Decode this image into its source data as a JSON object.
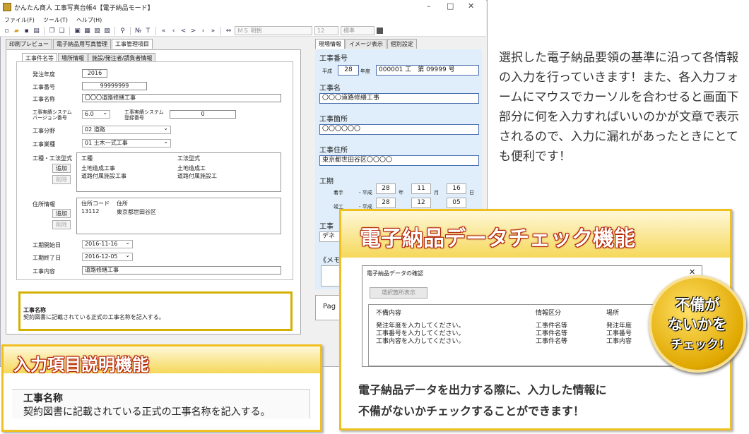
{
  "window": {
    "title": "かんたん商人 工事写真台帳4【電子納品モード】",
    "minimize": "–",
    "maximize": "□",
    "close": "✕"
  },
  "menu": [
    "ファイル(F)",
    "ツール(T)",
    "ヘルプ(H)"
  ],
  "toolbar": {
    "font_name": "ＭＳ 明朝",
    "font_size": "12",
    "style": "標準"
  },
  "main_tabs": [
    "印刷プレビュー",
    "電子納品用写真管理",
    "工事管理項目"
  ],
  "sub_tabs": [
    "工事件名等",
    "場所情報",
    "施設/発注者/請負者情報"
  ],
  "form": {
    "year_label": "発注年度",
    "year": "2016",
    "no_label": "工事番号",
    "no": "99999999",
    "name_label": "工事名称",
    "name": "〇〇〇道路修繕工事",
    "sys_ver_label1": "工事実績システム",
    "sys_ver_label2": "バージョン番号",
    "sys_ver": "6.0",
    "sys_no_label1": "工事実績システム",
    "sys_no_label2": "登録番号",
    "sys_no": "0",
    "field_label": "工事分野",
    "field": "02 道路",
    "type_label": "工事業種",
    "type": "01 土木一式工事",
    "method_label": "工種・工法型式",
    "add": "追加",
    "delete": "削除",
    "method_cols": [
      "工種",
      "工法型式"
    ],
    "method_rows": [
      [
        "土地造成工事",
        "土地造成工"
      ],
      [
        "道路付属施設工事",
        "道路付属施設工"
      ]
    ],
    "place_label": "住所情報",
    "place_cols": [
      "住所コード",
      "住所"
    ],
    "place_rows": [
      [
        "13112",
        "東京都世田谷区"
      ]
    ],
    "start_label": "工期開始日",
    "start": "2016-11-16",
    "end_label": "工期終了日",
    "end": "2016-12-05",
    "content_label": "工事内容",
    "content": "道路修繕工事"
  },
  "help": {
    "title": "工事名称",
    "text": "契約図書に記載されている正式の工事名称を記入する。"
  },
  "right_tabs": [
    "現場情報",
    "イメージ表示",
    "個別設定"
  ],
  "right": {
    "no_label": "工事番号",
    "era": "平成",
    "era_year": "28",
    "year_unit": "年度",
    "no_value": "000001 工　第 09999 号",
    "name_label": "工事名",
    "name": "〇〇〇道路修繕工事",
    "place_label": "工事箇所",
    "place": "〇〇〇〇〇〇",
    "addr_label": "工事住所",
    "addr": "東京都世田谷区〇〇〇〇",
    "period_label": "工期",
    "start_label": "着手",
    "start_era": "- 平成",
    "start_y": "28",
    "start_m": "11",
    "start_d": "16",
    "end_label": "竣工",
    "end_era": "- 平成",
    "end_y": "28",
    "end_m": "12",
    "end_d": "05",
    "y_unit": "年",
    "m_unit": "月",
    "d_unit": "日",
    "partial_label1": "工事",
    "partial_value1": "デネ",
    "memo": "《メモ",
    "page": "Pag"
  },
  "description": "選択した電子納品要領の基準に沿って各情報の入力を行っていきます！また、各入力フォームにマウスでカーソルを合わせると画面下部分に何を入力すればいいのかが文章で表示されるので、入力に漏れがあったときにとても便利です！",
  "feature1": {
    "title": "入力項目説明機能",
    "help_title": "工事名称",
    "help_text": "契約図書に記載されている正式の工事名称を記入する。"
  },
  "feature2": {
    "title": "電子納品データチェック機能",
    "dialog_title": "電子納品データの確認",
    "dialog_btn": "選択箇所表示",
    "cols": [
      "不備内容",
      "情報区分",
      "場所"
    ],
    "rows": [
      [
        "発注年度を入力してください。",
        "工事件名等",
        "発注年度"
      ],
      [
        "工事番号を入力してください。",
        "工事件名等",
        "工事番号"
      ],
      [
        "工事内容を入力してください。",
        "工事件名等",
        "工事内容"
      ]
    ],
    "caption1": "電子納品データを出力する際に、入力した情報に",
    "caption2": "不備がないかチェックすることができます！"
  },
  "badge": [
    "不備が",
    "ないかを",
    "チェック!"
  ]
}
